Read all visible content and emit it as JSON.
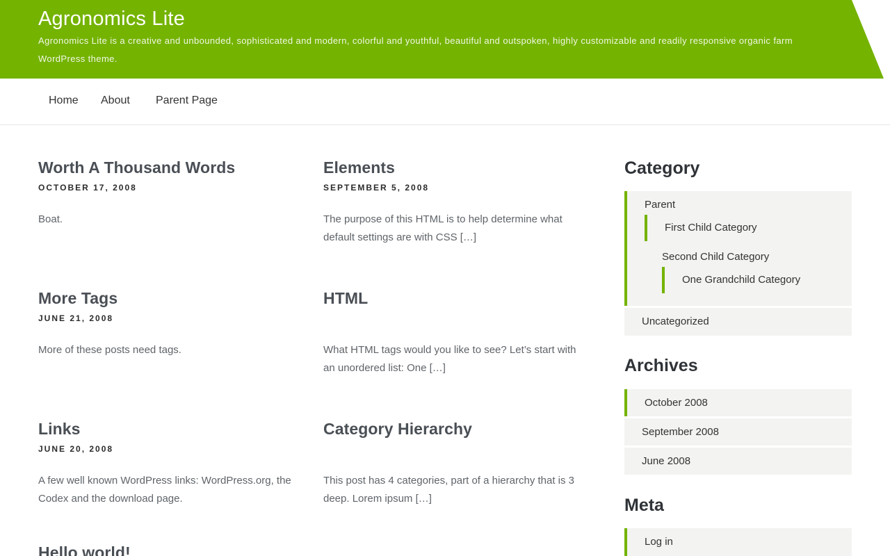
{
  "site": {
    "title": "Agronomics Lite",
    "description": "Agronomics Lite is a creative and unbounded, sophisticated and modern, colorful and youthful, beautiful and outspoken, highly customizable and readily responsive organic farm WordPress theme.",
    "accent_color": "#74b300"
  },
  "nav": {
    "items": [
      {
        "label": "Home"
      },
      {
        "label": "About"
      },
      {
        "label": "Parent Page"
      }
    ]
  },
  "posts": [
    {
      "title": "Worth A Thousand Words",
      "date": "October 17, 2008",
      "excerpt": "Boat."
    },
    {
      "title": "Elements",
      "date": "September 5, 2008",
      "excerpt": "The purpose of this HTML is to help determine what default settings are with CSS […]"
    },
    {
      "title": "More Tags",
      "date": "June 21, 2008",
      "excerpt": "More of these posts need tags."
    },
    {
      "title": "HTML",
      "date": "",
      "excerpt": "What HTML tags would you like to see? Let’s start with an unordered list: One […]"
    },
    {
      "title": "Links",
      "date": "June 20, 2008",
      "excerpt": "A few well known WordPress links: WordPress.org, the Codex and the download page."
    },
    {
      "title": "Category Hierarchy",
      "date": "",
      "excerpt": "This post has 4 categories, part of a hierarchy that is 3 deep. Lorem ipsum […]"
    },
    {
      "title": "Hello world!"
    }
  ],
  "sidebar": {
    "category": {
      "title": "Category",
      "items": [
        {
          "label": "Parent"
        },
        {
          "label": "First Child Category"
        },
        {
          "label": "Second Child Category"
        },
        {
          "label": "One Grandchild Category"
        },
        {
          "label": "Uncategorized"
        }
      ]
    },
    "archives": {
      "title": "Archives",
      "items": [
        {
          "label": "October 2008"
        },
        {
          "label": "September 2008"
        },
        {
          "label": "June 2008"
        }
      ]
    },
    "meta": {
      "title": "Meta",
      "items": [
        {
          "label": "Log in"
        }
      ]
    }
  }
}
